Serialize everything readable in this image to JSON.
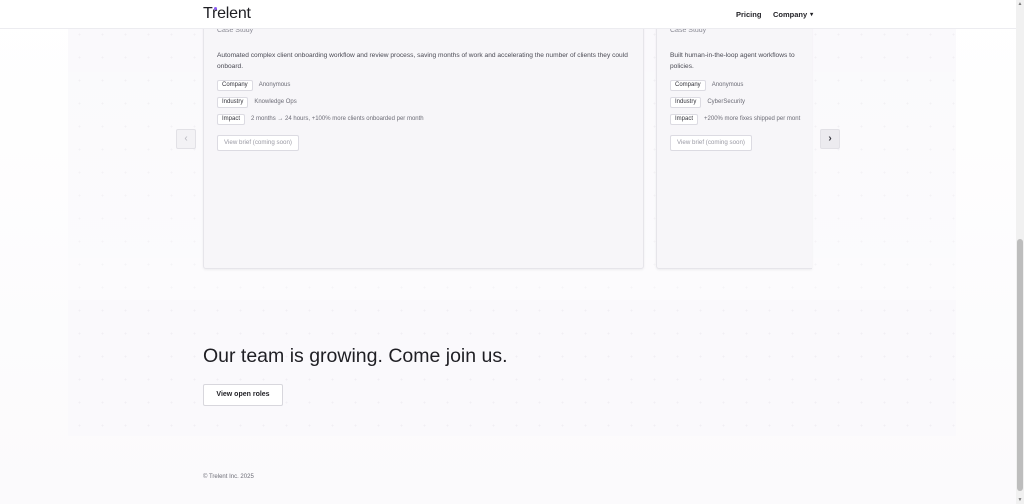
{
  "header": {
    "logo": "Trelent",
    "nav": {
      "pricing": "Pricing",
      "company": "Company"
    }
  },
  "carousel": {
    "cards": [
      {
        "eyebrow": "Case Study",
        "description": "Automated complex client onboarding workflow and review process, saving months of work and accelerating the number of clients they could onboard.",
        "company_label": "Company",
        "company_value": "Anonymous",
        "industry_label": "Industry",
        "industry_value": "Knowledge Ops",
        "impact_label": "Impact",
        "impact_value": "2 months → 24 hours, +100% more clients onboarded per month",
        "brief_label": "View brief (coming soon)"
      },
      {
        "eyebrow": "Case Study",
        "description": "Built human-in-the-loop agent workflows to policies.",
        "company_label": "Company",
        "company_value": "Anonymous",
        "industry_label": "Industry",
        "industry_value": "CyberSecurity",
        "impact_label": "Impact",
        "impact_value": "+200% more fixes shipped per mont",
        "brief_label": "View brief (coming soon)"
      }
    ],
    "prev_icon": "‹",
    "next_icon": "›"
  },
  "join": {
    "title": "Our team is growing. Come join us.",
    "button": "View open roles"
  },
  "footer": {
    "copyright": "© Trelent Inc. 2025"
  },
  "icons": {
    "prev": "chevron-left-icon",
    "next": "chevron-right-icon",
    "company_dropdown": "chevron-down-icon"
  },
  "colors": {
    "accent": "#8b5cf6",
    "text": "#1f1f24",
    "card_bg": "#f7f6f9"
  }
}
